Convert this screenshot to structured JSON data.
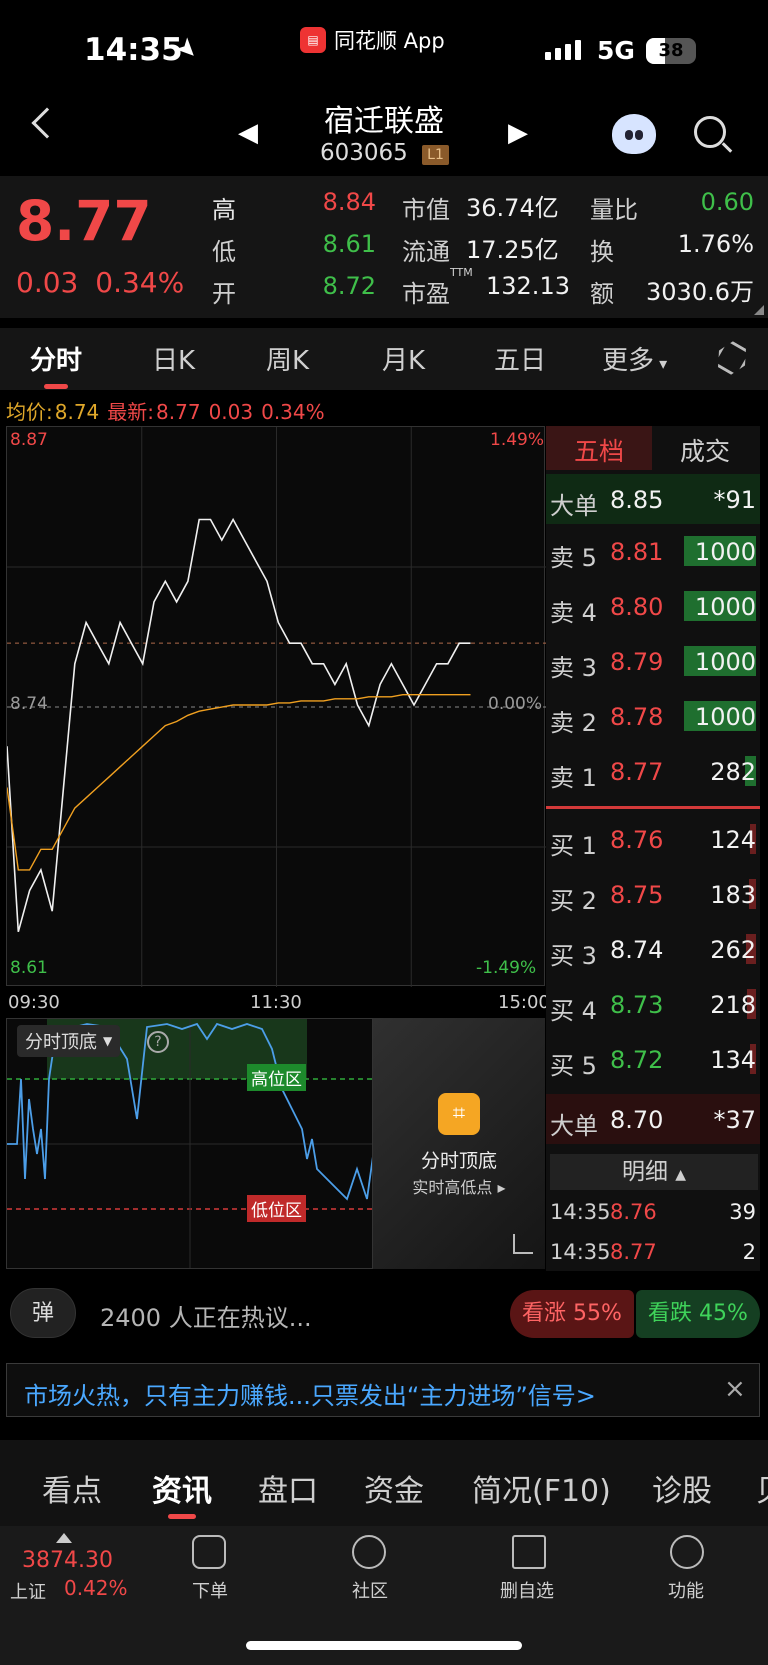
{
  "status": {
    "time": "14:35",
    "app": "同花顺 App",
    "network": "5G",
    "battery": "38",
    "battery_level": 0.38
  },
  "header": {
    "name": "宿迁联盛",
    "code": "603065",
    "level": "L1"
  },
  "quote": {
    "price": "8.77",
    "change": "0.03",
    "change_pct": "0.34%",
    "rows": [
      {
        "l1": "高",
        "v1": "8.84",
        "l2": "市值",
        "v2": "36.74亿",
        "l3": "量比",
        "v3": "0.60"
      },
      {
        "l1": "低",
        "v1": "8.61",
        "l2": "流通",
        "v2": "17.25亿",
        "l3": "换",
        "v3": "1.76%"
      },
      {
        "l1": "开",
        "v1": "8.72",
        "l2": "市盈",
        "l2_sup": "TTM",
        "v2": "132.13",
        "l3": "额",
        "v3": "3030.6万"
      }
    ]
  },
  "tabs": [
    "分时",
    "日K",
    "周K",
    "月K",
    "五日",
    "更多"
  ],
  "avg_line": {
    "avg_label": "均价:",
    "avg": "8.74",
    "last_label": "最新:",
    "last": "8.77",
    "chg": "0.03",
    "pct": "0.34%"
  },
  "chart_data": {
    "type": "line",
    "y_top": "8.87",
    "y_mid": "8.74",
    "y_bottom": "8.61",
    "pct_top": "1.49%",
    "pct_mid": "0.00%",
    "pct_bottom": "-1.49%",
    "x_labels": [
      "09:30",
      "11:30",
      "15:00"
    ],
    "ylim": [
      8.61,
      8.87
    ],
    "series": [
      {
        "values": [
          8.72,
          8.63,
          8.65,
          8.66,
          8.64,
          8.7,
          8.76,
          8.78,
          8.77,
          8.76,
          8.78,
          8.77,
          8.76,
          8.79,
          8.8,
          8.79,
          8.8,
          8.83,
          8.83,
          8.82,
          8.83,
          8.82,
          8.81,
          8.8,
          8.78,
          8.77,
          8.77,
          8.76,
          8.76,
          8.75,
          8.76,
          8.74,
          8.73,
          8.75,
          8.76,
          8.75,
          8.74,
          8.75,
          8.76,
          8.76,
          8.77,
          8.77
        ]
      },
      {
        "values": [
          8.7,
          8.66,
          8.66,
          8.67,
          8.67,
          8.68,
          8.69,
          8.695,
          8.7,
          8.705,
          8.71,
          8.715,
          8.72,
          8.725,
          8.73,
          8.732,
          8.735,
          8.737,
          8.738,
          8.739,
          8.74,
          8.74,
          8.74,
          8.74,
          8.741,
          8.741,
          8.742,
          8.742,
          8.742,
          8.743,
          8.743,
          8.743,
          8.744,
          8.744,
          8.744,
          8.745,
          8.745,
          8.745,
          8.745,
          8.745,
          8.745,
          8.745
        ]
      }
    ]
  },
  "indicator": {
    "title": "分时顶底",
    "high_zone": "高位区",
    "low_zone": "低位区",
    "card_title": "分时顶底",
    "card_sub": "实时高低点"
  },
  "book": {
    "tab_active": "五档",
    "tab_other": "成交",
    "big_sell": {
      "label": "大单",
      "price": "8.85",
      "vol": "*91"
    },
    "sells": [
      {
        "label": "卖 5",
        "price": "8.81",
        "vol": "1000",
        "fill": 1.0
      },
      {
        "label": "卖 4",
        "price": "8.80",
        "vol": "1000",
        "fill": 1.0
      },
      {
        "label": "卖 3",
        "price": "8.79",
        "vol": "1000",
        "fill": 1.0
      },
      {
        "label": "卖 2",
        "price": "8.78",
        "vol": "1000",
        "fill": 1.0
      },
      {
        "label": "卖 1",
        "price": "8.77",
        "vol": "282",
        "fill": 0.15
      }
    ],
    "buys": [
      {
        "label": "买 1",
        "price": "8.76",
        "vol": "124",
        "fill": 0.07
      },
      {
        "label": "买 2",
        "price": "8.75",
        "vol": "183",
        "fill": 0.1
      },
      {
        "label": "买 3",
        "price": "8.74",
        "vol": "262",
        "fill": 0.14
      },
      {
        "label": "买 4",
        "price": "8.73",
        "vol": "218",
        "fill": 0.12
      },
      {
        "label": "买 5",
        "price": "8.72",
        "vol": "134",
        "fill": 0.07
      }
    ],
    "big_buy": {
      "label": "大单",
      "price": "8.70",
      "vol": "*37"
    },
    "detail_label": "明细",
    "ticks": [
      {
        "time": "14:35",
        "price": "8.76",
        "vol": "39"
      },
      {
        "time": "14:35",
        "price": "8.77",
        "vol": "2"
      }
    ]
  },
  "hot": {
    "danmu": "弹",
    "discuss": "2400 人正在热议...",
    "up": "看涨 55%",
    "down": "看跌 45%"
  },
  "banner": {
    "text": "市场火热，只有主力赚钱...只票发出“主力进场”信号>",
    "close": "×"
  },
  "news_tabs": [
    "看点",
    "资讯",
    "盘口",
    "资金",
    "简况(F10)",
    "诊股",
    "贝"
  ],
  "bottom_nav": {
    "index_value": "3874.30",
    "index_name": "上证",
    "index_pct": "0.42%",
    "items": [
      "下单",
      "社区",
      "删自选",
      "功能"
    ]
  }
}
